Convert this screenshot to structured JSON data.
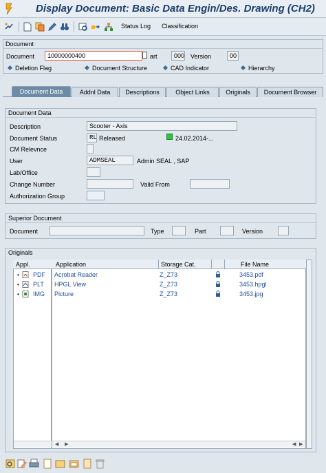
{
  "title": "Display Document: Basic Data Engin/Des. Drawing (CH2)",
  "toolbar": {
    "status_log": "Status Log",
    "classification": "Classification"
  },
  "doc": {
    "section": "Document",
    "document_label": "Document",
    "document_value": "10000000400",
    "part_label": "art",
    "part_value": "000",
    "version_label": "Version",
    "version_value": "00",
    "deletion_flag": "Deletion Flag",
    "document_structure": "Document Structure",
    "cad_indicator": "CAD Indicator",
    "hierarchy": "Hierarchy"
  },
  "tabs": [
    "Document Data",
    "Addnl Data",
    "Descriptions",
    "Object Links",
    "Originals",
    "Document Browser"
  ],
  "document_data": {
    "section": "Document Data",
    "description_label": "Description",
    "description_value": "Scooter - Axis",
    "status_label": "Document Status",
    "status_code": "RL",
    "status_text": "Released",
    "status_date": "24.02.2014-...",
    "cm_label": "CM Relevnce",
    "user_label": "User",
    "user_value": "ADMSEAL",
    "user_name": "Admin SEAL , SAP",
    "lab_label": "Lab/Office",
    "change_label": "Change Number",
    "valid_from_label": "Valid From",
    "auth_label": "Authorization Group",
    "status_color": "#2fc43a"
  },
  "superior": {
    "section": "Superior Document",
    "document_label": "Document",
    "type_label": "Type",
    "part_label": "Part",
    "version_label": "Version"
  },
  "originals": {
    "section": "Originals",
    "columns": [
      "Appl.",
      "Application",
      "Storage Cat.",
      "File Name"
    ],
    "rows": [
      {
        "appl": "PDF",
        "application": "Acrobat Reader",
        "storage": "Z_Z73",
        "file": "3453.pdf"
      },
      {
        "appl": "PLT",
        "application": "HPGL View",
        "storage": "Z_Z73",
        "file": "3453.hpgl"
      },
      {
        "appl": "IMG",
        "application": "Picture",
        "storage": "Z_Z73",
        "file": "3453.jpg"
      }
    ]
  },
  "colors": {
    "accent": "#1c3f6b",
    "link": "#1f4fa0",
    "tab_active": "#6d8ba6"
  }
}
